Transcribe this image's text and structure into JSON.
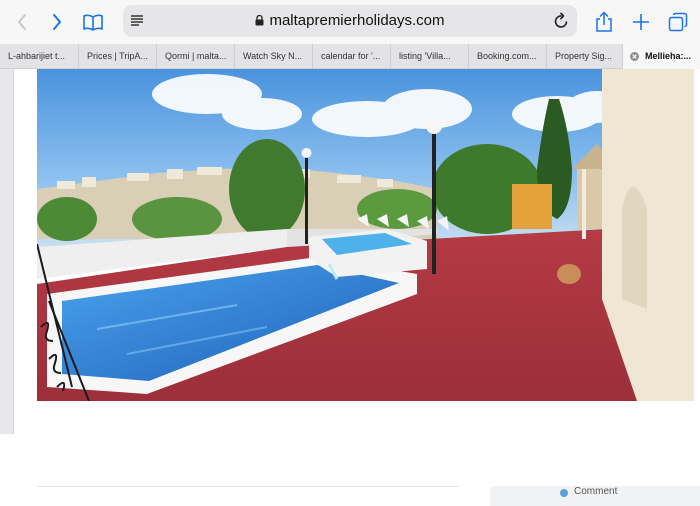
{
  "browser": {
    "url": "maltapremierholidays.com",
    "tabs": [
      {
        "label": "L-ahbarijiet t..."
      },
      {
        "label": "Prices | TripA..."
      },
      {
        "label": "Qormi | malta..."
      },
      {
        "label": "Watch Sky N..."
      },
      {
        "label": "calendar for '..."
      },
      {
        "label": "listing 'Villa..."
      },
      {
        "label": "Booking.com..."
      },
      {
        "label": "Property Sig..."
      },
      {
        "label": "Mellieha:..."
      }
    ]
  },
  "page": {
    "comment_label": "Comment"
  },
  "colors": {
    "toolbar_icon": "#1a73e8",
    "disabled_icon": "#c7c7cc",
    "pool_deck": "#a3323f",
    "pool_water": "#2f7fd8"
  }
}
